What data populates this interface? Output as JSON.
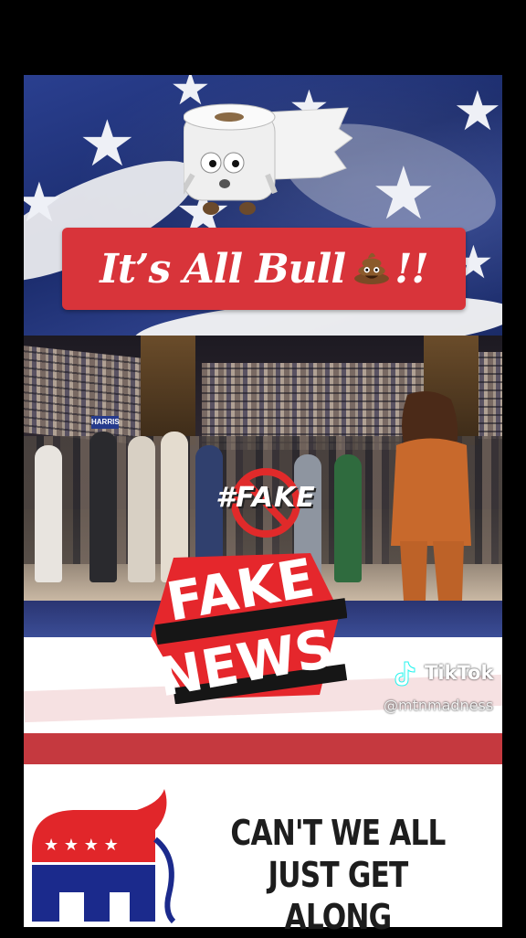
{
  "banner": {
    "text": "It’s All Bull",
    "suffix": "!!"
  },
  "photo_overlay": {
    "label": "#FAKE"
  },
  "fake_news": {
    "line1": "FAKE",
    "line2": "NEWS"
  },
  "watermark": {
    "brand": "TikTok",
    "handle": "@mtnmadness"
  },
  "slogan": {
    "line1": "CAN'T WE ALL",
    "line2": "JUST GET ALONG"
  },
  "screen_sign": {
    "text": "HARRIS"
  },
  "icons": [
    "toilet-paper-icon",
    "poop-emoji-icon",
    "no-symbol-icon",
    "tiktok-logo-icon",
    "gop-elephant-icon"
  ],
  "colors": {
    "banner_red": "#d8343a",
    "flag_blue": "#1c2f73",
    "flag_red": "#c5393f"
  }
}
